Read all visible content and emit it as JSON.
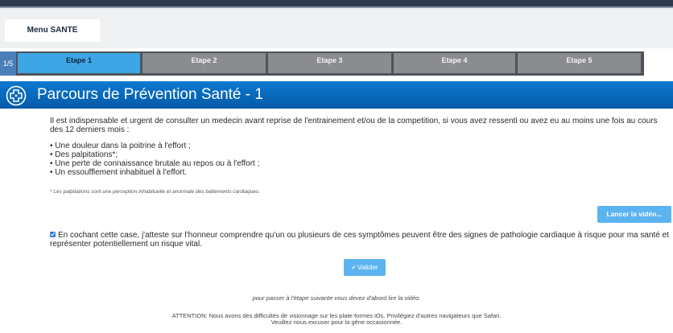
{
  "menu": {
    "label": "Menu SANTE"
  },
  "steps": {
    "count": "1/5",
    "items": [
      {
        "label": "Etape 1",
        "active": true
      },
      {
        "label": "Etape 2",
        "active": false
      },
      {
        "label": "Etape 3",
        "active": false
      },
      {
        "label": "Etape 4",
        "active": false
      },
      {
        "label": "Etape 5",
        "active": false
      }
    ]
  },
  "banner": {
    "title": "Parcours de Prévention Santé - 1",
    "icon": "health-cross-icon"
  },
  "content": {
    "intro": "Il est indispensable et urgent de consulter un medecin avant reprise de l'entrainement et/ou de la competition, si vous avez ressenti ou avez eu au moins une fois au cours des 12 derniers mois :",
    "symptoms": [
      "Une douleur dans la poitrine à l'effort ;",
      "Des palpitations*;",
      "Une perte de connaissance brutale au repos ou à l'effort ;",
      "Un essoufflement inhabituel à l'effort."
    ],
    "footnote": "* Les palpitations sont une perception inhabituelle et anormale des battements cardiaques."
  },
  "video_button": {
    "label": "Lancer la vidéo..."
  },
  "attestation": {
    "checked": true,
    "text": "En cochant cette case, j'atteste sur l'honneur comprendre qu'un ou plusieurs de ces symptômes peuvent être des signes de pathologie cardiaque à risque pour ma santé et représenter potentiellement un risque vital."
  },
  "validate_button": {
    "label": "Valider"
  },
  "notes": {
    "video_required": "pour passer à l'étape suivante vous devez d'abord lire la vidéo.",
    "attention_1": "ATTENTION: Nous avons des difficultés de visionnage sur les plate-formes iOs. Privilégiez d'autres navigateurs que Safari.",
    "attention_2": "Veuillez nous excuser pour la gêne occasionnée."
  }
}
